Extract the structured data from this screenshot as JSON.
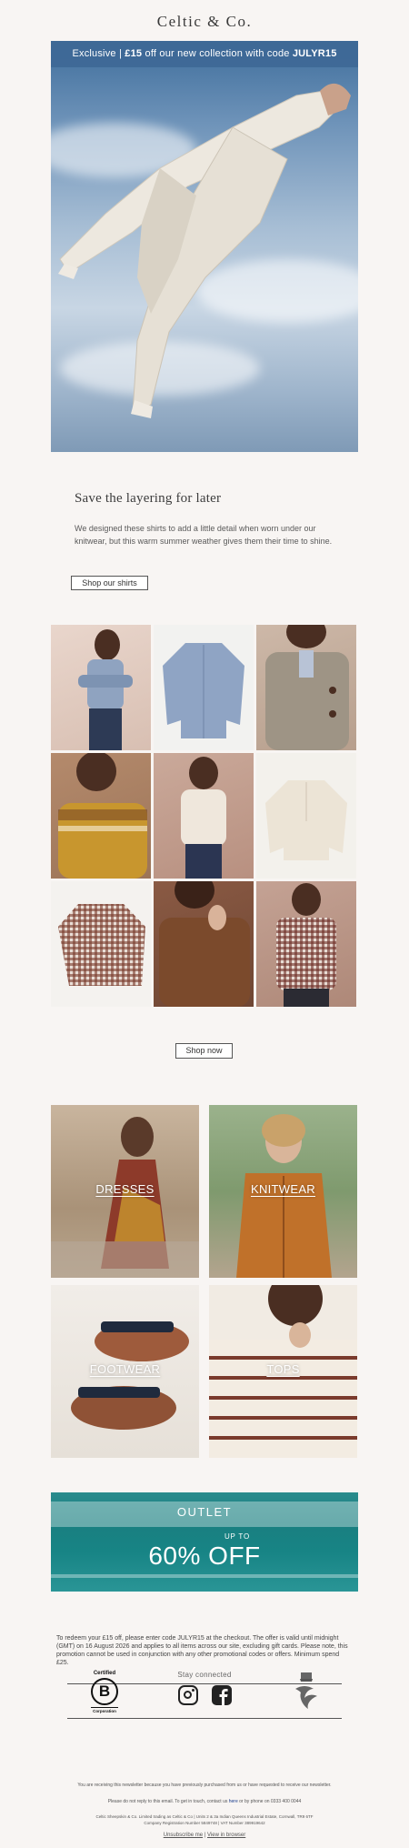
{
  "header": {
    "logo_text": "Celtic & Co."
  },
  "hero": {
    "banner_prefix": "Exclusive |",
    "banner_offer": "£15",
    "banner_middle": "off our new collection with code",
    "banner_code": "JULYR15"
  },
  "intro": {
    "headline": "Save the layering for later",
    "body": "We designed these shirts to add a little detail when worn under our knitwear, but this warm summer weather gives them their time to shine.",
    "cta": "Shop our shirts"
  },
  "grid": {
    "cta": "Shop now"
  },
  "categories": [
    {
      "label": "DRESSES"
    },
    {
      "label": "KNITWEAR"
    },
    {
      "label": "FOOTWEAR"
    },
    {
      "label": "TOPS"
    }
  ],
  "outlet": {
    "title": "OUTLET",
    "upto": "UP TO",
    "discount": "60% OFF"
  },
  "terms": "To redeem your £15 off, please enter code JULYR15 at the checkout. The offer is valid until midnight (GMT) on 16 August 2026 and applies to all items across our site, excluding gift cards. Please note, this promotion cannot be used in conjunction with any other promotional codes or offers. Minimum spend £25.",
  "footer": {
    "bcorp_top": "Certified",
    "bcorp_letter": "B",
    "bcorp_bottom": "Corporation",
    "stay_connected": "Stay connected",
    "reason": "You are receiving this newsletter because you have previously purchased from us or have requested to receive our newsletter.",
    "noreply_prefix": "Please do not reply to this email. To get in touch, contact us",
    "noreply_link": "here",
    "noreply_suffix": "or by phone on 0333 400 0044",
    "company_line1": "Celtic Sheepskin & Co. Limited trading as Celtic & Co | Units 2 & 3a Indian Queens Industrial Estate, Cornwall, TR9 6TF",
    "company_line2": "Company Registration Number 5849748 | VAT Number 389919642",
    "unsubscribe": "Unsubscribe me",
    "separator": "|",
    "view_browser": "View in browser"
  },
  "colors": {
    "background": "#f8f5f3",
    "banner": "#3e6896",
    "outlet": "#1a7f80"
  }
}
